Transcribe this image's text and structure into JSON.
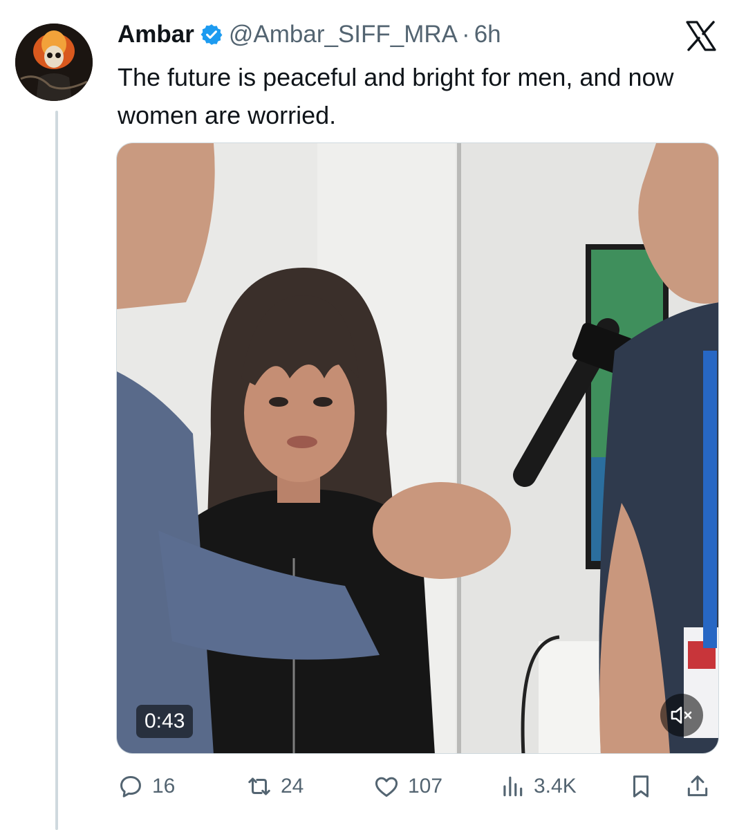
{
  "tweet": {
    "author_name": "Ambar",
    "handle": "@Ambar_SIFF_MRA",
    "separator": "·",
    "time": "6h",
    "text": "The future is peaceful and bright for men, and now women are worried."
  },
  "media": {
    "duration": "0:43",
    "mute_icon": "speaker-muted-icon"
  },
  "actions": {
    "replies": "16",
    "reposts": "24",
    "likes": "107",
    "views": "3.4K"
  },
  "colors": {
    "text": "#0f1419",
    "secondary": "#536471",
    "verified": "#1d9bf0",
    "thread_line": "#cfd9de"
  }
}
